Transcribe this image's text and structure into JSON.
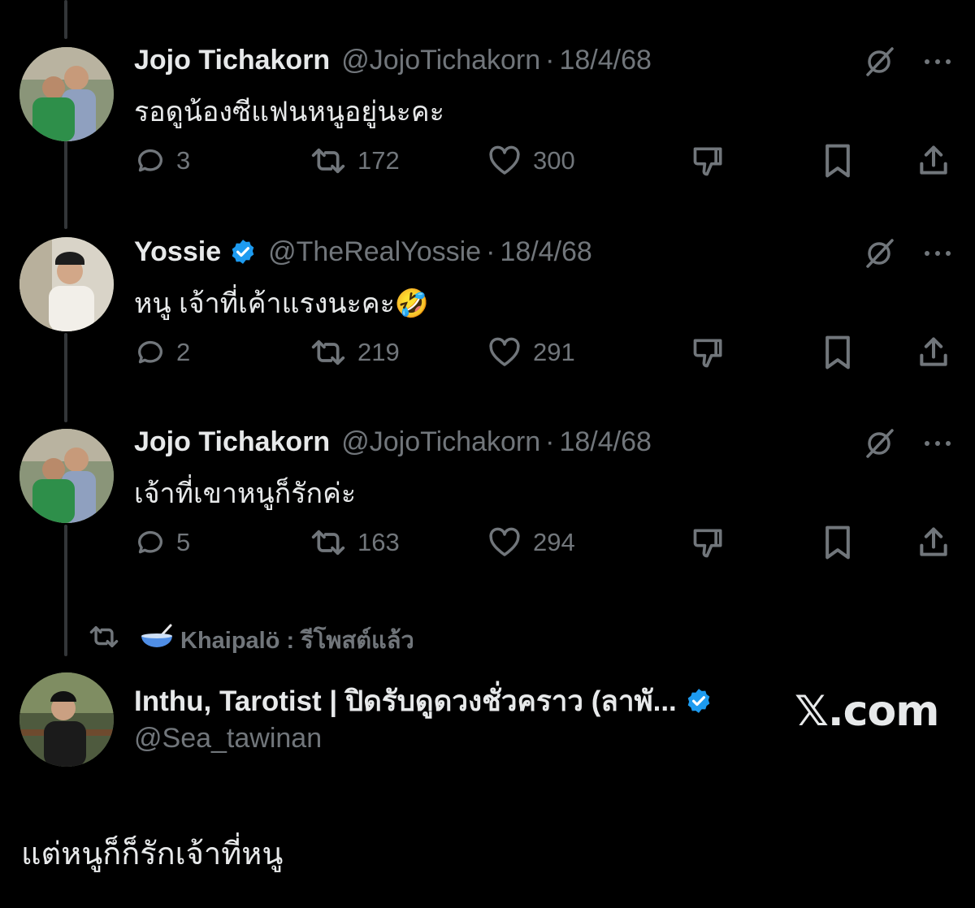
{
  "tweets": [
    {
      "name": "Jojo Tichakorn",
      "handle": "@JojoTichakorn",
      "separator": "·",
      "date": "18/4/68",
      "text": "รอดูน้องซีแฟนหนูอยู่นะคะ",
      "verified": false,
      "replies": "3",
      "reposts": "172",
      "likes": "300"
    },
    {
      "name": "Yossie",
      "handle": "@TheRealYossie",
      "separator": "·",
      "date": "18/4/68",
      "text": "หนู เจ้าที่เค้าแรงนะคะ🤣",
      "verified": true,
      "replies": "2",
      "reposts": "219",
      "likes": "291"
    },
    {
      "name": "Jojo Tichakorn",
      "handle": "@JojoTichakorn",
      "separator": "·",
      "date": "18/4/68",
      "text": "เจ้าที่เขาหนูก็รักค่ะ",
      "verified": false,
      "replies": "5",
      "reposts": "163",
      "likes": "294"
    }
  ],
  "repost_notice": {
    "user": "Khaipalö : รีโพสต์แล้ว"
  },
  "profile": {
    "name": "Inthu, Tarotist | ปิดรับดูดวงชั่วคราว (ลาพั...",
    "handle": "@Sea_tawinan",
    "verified": true
  },
  "watermark": "𝕏.com",
  "quote_text": "แต่หนูก็ก็รักเจ้าที่หนู",
  "colors": {
    "background": "#000000",
    "text": "#e7e9ea",
    "muted": "#71767b",
    "verified": "#1d9bf0",
    "thread_line": "#333639"
  },
  "icons": [
    "reply-icon",
    "repost-icon",
    "like-icon",
    "dislike-icon",
    "bookmark-icon",
    "share-icon",
    "grok-icon",
    "more-icon",
    "verified-icon"
  ]
}
